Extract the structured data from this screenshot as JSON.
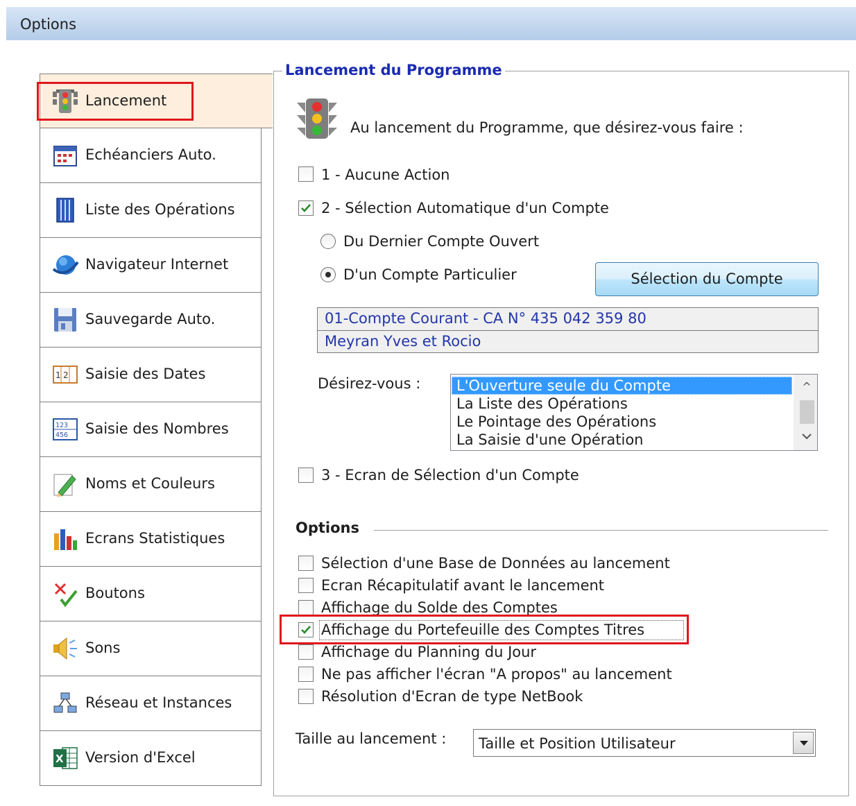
{
  "window": {
    "title": "Options"
  },
  "sidebar": {
    "items": [
      {
        "label": "Lancement",
        "icon": "traffic-light-icon"
      },
      {
        "label": "Echéanciers Auto.",
        "icon": "calendar-icon"
      },
      {
        "label": "Liste des Opérations",
        "icon": "list-columns-icon"
      },
      {
        "label": "Navigateur Internet",
        "icon": "globe-icon"
      },
      {
        "label": "Sauvegarde Auto.",
        "icon": "floppy-disk-icon"
      },
      {
        "label": "Saisie des Dates",
        "icon": "date-input-icon"
      },
      {
        "label": "Saisie des Nombres",
        "icon": "number-input-icon"
      },
      {
        "label": "Noms et Couleurs",
        "icon": "pencil-icon"
      },
      {
        "label": "Ecrans Statistiques",
        "icon": "bar-chart-icon"
      },
      {
        "label": "Boutons",
        "icon": "cross-check-icon"
      },
      {
        "label": "Sons",
        "icon": "speaker-icon"
      },
      {
        "label": "Réseau et Instances",
        "icon": "network-icon"
      },
      {
        "label": "Version d'Excel",
        "icon": "excel-icon"
      }
    ],
    "selected_index": 0
  },
  "panel": {
    "legend": "Lancement du Programme",
    "question": "Au lancement du Programme, que désirez-vous faire :",
    "choice1": {
      "label": "1 - Aucune Action",
      "checked": false
    },
    "choice2": {
      "label": "2 - Sélection Automatique d'un Compte",
      "checked": true
    },
    "radio_last": {
      "label": "Du Dernier Compte Ouvert",
      "selected": false
    },
    "radio_specific": {
      "label": "D'un Compte Particulier",
      "selected": true
    },
    "select_account_button": "Sélection du Compte",
    "account": {
      "line1": "01-Compte Courant - CA N° 435 042 359 80",
      "line2": "Meyran Yves et Rocio"
    },
    "desire_label": "Désirez-vous :",
    "desire_options": [
      "L'Ouverture seule du Compte",
      "La Liste des Opérations",
      "Le Pointage des Opérations",
      "La Saisie d'une Opération"
    ],
    "desire_selected": 0,
    "choice3": {
      "label": "3 - Ecran de Sélection d'un Compte",
      "checked": false
    },
    "options_header": "Options",
    "options": [
      {
        "label": "Sélection d'une Base de Données au lancement",
        "checked": false
      },
      {
        "label": "Ecran Récapitulatif avant le lancement",
        "checked": false
      },
      {
        "label": "Affichage du Solde des Comptes",
        "checked": false
      },
      {
        "label": "Affichage du Portefeuille des Comptes Titres",
        "checked": true
      },
      {
        "label": "Affichage du Planning du Jour",
        "checked": false
      },
      {
        "label": "Ne pas afficher l'écran \"A propos\" au lancement",
        "checked": false
      },
      {
        "label": "Résolution d'Ecran de type NetBook",
        "checked": false
      }
    ],
    "size_label": "Taille au lancement :",
    "size_value": "Taille et Position Utilisateur"
  },
  "colors": {
    "legend_text": "#1a2bb2",
    "account_text": "#2236a8",
    "selection_bg": "#3399ff",
    "highlight_box": "#e0161b",
    "active_tab_bg": "#fdeedd",
    "check_mark": "#2a8a2a"
  }
}
